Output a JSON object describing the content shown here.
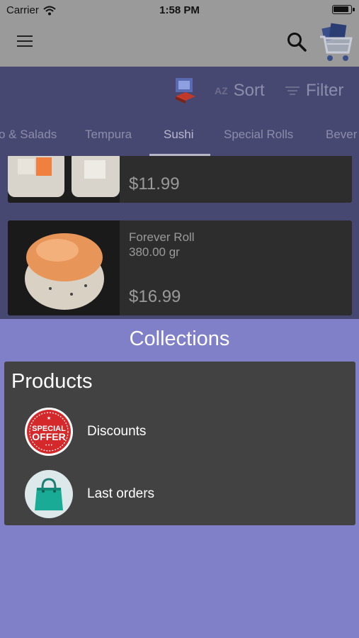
{
  "status": {
    "carrier": "Carrier",
    "time": "1:58 PM"
  },
  "toolbar": {
    "sort_label": "Sort",
    "sort_icon_text": "AZ",
    "filter_label": "Filter"
  },
  "tabs": [
    {
      "label": "o & Salads",
      "active": false
    },
    {
      "label": "Tempura",
      "active": false
    },
    {
      "label": "Sushi",
      "active": true
    },
    {
      "label": "Special Rolls",
      "active": false
    },
    {
      "label": "Bever",
      "active": false
    }
  ],
  "products": [
    {
      "name": "",
      "weight": "",
      "price": "$11.99"
    },
    {
      "name": "Forever Roll",
      "weight": "380.00 gr",
      "price": "$16.99"
    }
  ],
  "collections": {
    "title": "Collections",
    "section_title": "Products",
    "items": [
      {
        "label": "Discounts",
        "badge_line1": "SPECIAL",
        "badge_line2": "OFFER"
      },
      {
        "label": "Last orders"
      }
    ]
  },
  "colors": {
    "sheet": "#7f80c8",
    "panel": "#424242",
    "toolbar": "#474871",
    "card": "#2d2d2d"
  }
}
